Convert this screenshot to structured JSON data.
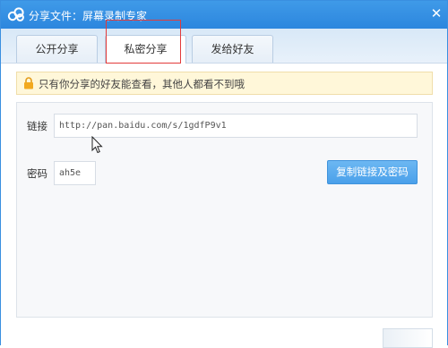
{
  "window": {
    "title": "分享文件：屏幕录制专家"
  },
  "tabs": [
    {
      "label": "公开分享",
      "active": false
    },
    {
      "label": "私密分享",
      "active": true
    },
    {
      "label": "发给好友",
      "active": false
    }
  ],
  "notice": {
    "text": "只有你分享的好友能查看，其他人都看不到哦"
  },
  "form": {
    "link_label": "链接",
    "link_value": "http://pan.baidu.com/s/1gdfP9v1",
    "password_label": "密码",
    "password_value": "ah5e"
  },
  "actions": {
    "copy_label": "复制链接及密码"
  },
  "colors": {
    "accent": "#2c86de",
    "button": "#4aa0ea",
    "notice_bg": "#fff7d9",
    "highlight": "#e23b3b"
  }
}
